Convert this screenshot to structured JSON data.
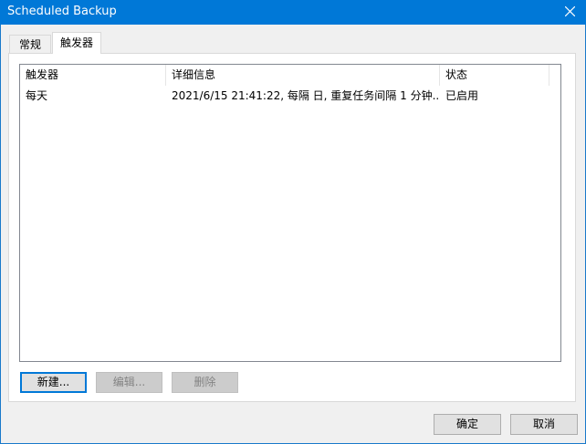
{
  "window": {
    "title": "Scheduled Backup",
    "close_icon": "close-icon"
  },
  "tabs": [
    {
      "label": "常规",
      "active": false
    },
    {
      "label": "触发器",
      "active": true
    }
  ],
  "triggers_table": {
    "columns": [
      "触发器",
      "详细信息",
      "状态"
    ],
    "rows": [
      {
        "trigger": "每天",
        "details": "2021/6/15 21:41:22, 每隔 日, 重复任务间隔 1 分钟...",
        "status": "已启用"
      }
    ]
  },
  "panel_buttons": {
    "new": "新建...",
    "edit": "编辑...",
    "delete": "删除"
  },
  "dialog_buttons": {
    "ok": "确定",
    "cancel": "取消"
  },
  "colors": {
    "titlebar": "#0078d7",
    "default_button_border": "#0078d7"
  }
}
